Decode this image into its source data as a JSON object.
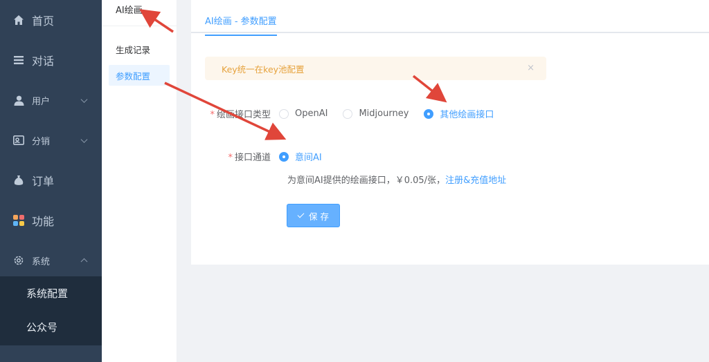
{
  "sidebar": {
    "items": [
      {
        "label": "首页"
      },
      {
        "label": "对话"
      },
      {
        "label": "用户"
      },
      {
        "label": "分销"
      },
      {
        "label": "订单"
      },
      {
        "label": "功能"
      },
      {
        "label": "系统"
      }
    ],
    "system_submenu": [
      {
        "label": "系统配置"
      },
      {
        "label": "公众号"
      }
    ]
  },
  "submenu": {
    "title": "AI绘画",
    "items": [
      {
        "label": "生成记录"
      },
      {
        "label": "参数配置"
      }
    ]
  },
  "main": {
    "tab": "AI绘画 - 参数配置",
    "alert": "Key统一在key池配置",
    "alert_close": "×",
    "form": {
      "interface_type_label": "绘画接口类型",
      "interface_options": [
        "OpenAI",
        "Midjourney",
        "其他绘画接口"
      ],
      "channel_label": "接口通道",
      "channel_option": "意间AI",
      "hint_text": "为意间AI提供的绘画接口，￥0.05/张，",
      "hint_link": "注册&充值地址",
      "save_label": "保 存"
    }
  },
  "colors": {
    "sidebar_bg": "#304156",
    "submenu_bg": "#1f2d3d",
    "primary": "#409eff",
    "warning_bg": "#fdf6ec",
    "warning_text": "#e6a23c",
    "annotation": "#e0463a"
  }
}
